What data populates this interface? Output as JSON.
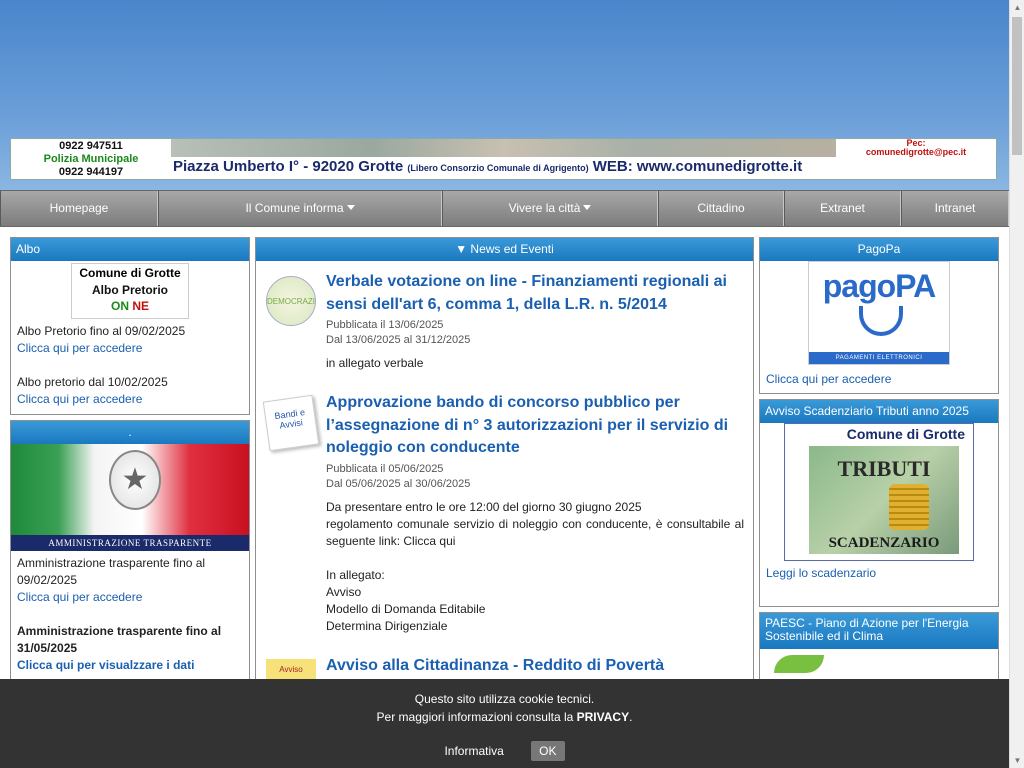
{
  "banner": {
    "phone1": "0922 947511",
    "phone_label": "Polizia Municipale",
    "phone2": "0922 944197",
    "address": "Piazza Umberto I°  - 92020 Grotte",
    "address_small": "(Libero Consorzio Comunale di Agrigento)",
    "web": "WEB: www.comunedigrotte.it",
    "pec_label": "Pec:",
    "pec": "comunedigrotte@pec.it"
  },
  "nav": [
    {
      "label": "Homepage",
      "dropdown": false
    },
    {
      "label": "Il Comune informa",
      "dropdown": true
    },
    {
      "label": "Vivere la città",
      "dropdown": true
    },
    {
      "label": "Cittadino",
      "dropdown": false
    },
    {
      "label": "Extranet",
      "dropdown": false
    },
    {
      "label": "Intranet",
      "dropdown": false
    }
  ],
  "albo": {
    "title": "Albo",
    "logo_line1": "Comune di Grotte",
    "logo_line2": "Albo Pretorio",
    "logo_line3a": "ON",
    "logo_line3b": "NE",
    "text1": "Albo Pretorio fino al 09/02/2025",
    "link1": "Clicca qui per accedere",
    "text2": "Albo pretorio dal 10/02/2025",
    "link2": "Clicca qui per accedere"
  },
  "trasparente": {
    "title": ".",
    "banner_text": "AMMINISTRAZIONE TRASPARENTE",
    "text1": "Amministrazione trasparente fino al 09/02/2025",
    "link1": "Clicca qui per accedere",
    "text2": "Amministrazione trasparente fino al 31/05/2025",
    "link2": "Clicca qui per visualzzare i dati"
  },
  "news": {
    "title": "▼ News ed Eventi",
    "items": [
      {
        "title": "Verbale votazione on line - Finanziamenti regionali ai sensi dell'art 6, comma 1, della L.R. n. 5/2014",
        "published": "Pubblicata il 13/06/2025",
        "range": "Dal 13/06/2025 al 31/12/2025",
        "desc": "in allegato verbale",
        "thumb": "DEMOCRAZIA"
      },
      {
        "title": "Approvazione bando di concorso pubblico per l’assegnazione di n° 3 autorizzazioni per il servizio di noleggio con conducente",
        "published": "Pubblicata il 05/06/2025",
        "range": "Dal 05/06/2025 al 30/06/2025",
        "desc1": "Da presentare entro le ore 12:00 del giorno 30 giugno 2025",
        "desc2": "regolamento comunale servizio di noleggio con conducente, è consultabile al seguente link:   Clicca qui",
        "desc3": "In allegato:",
        "desc4": "Avviso",
        "desc5": "Modello di Domanda Editabile",
        "desc6": "Determina Dirigenziale",
        "thumb": "Bandi e Avvisi"
      },
      {
        "title": "Avviso alla Cittadinanza - Reddito di Povertà",
        "thumb": "Avviso"
      }
    ]
  },
  "pagopa": {
    "title": "PagoPa",
    "logo": "pagoPA",
    "strip": "PAGAMENTI   ELETTRONICI",
    "link": "Clicca qui per accedere"
  },
  "tributi": {
    "title": "Avviso Scadenziario Tributi anno 2025",
    "logo_header": "Comune di Grotte",
    "logo_word": "TRIBUTI",
    "logo_sub": "SCADENZARIO",
    "link": "Leggi lo scadenzario"
  },
  "paesc": {
    "title": "PAESC - Piano di Azione per l'Energia Sostenibile ed il Clima"
  },
  "cookie": {
    "line1": "Questo sito utilizza cookie tecnici.",
    "line2_pre": "Per maggiori informazioni consulta la ",
    "line2_bold": "PRIVACY",
    "line2_post": ".",
    "info": "Informativa",
    "ok": "OK"
  }
}
